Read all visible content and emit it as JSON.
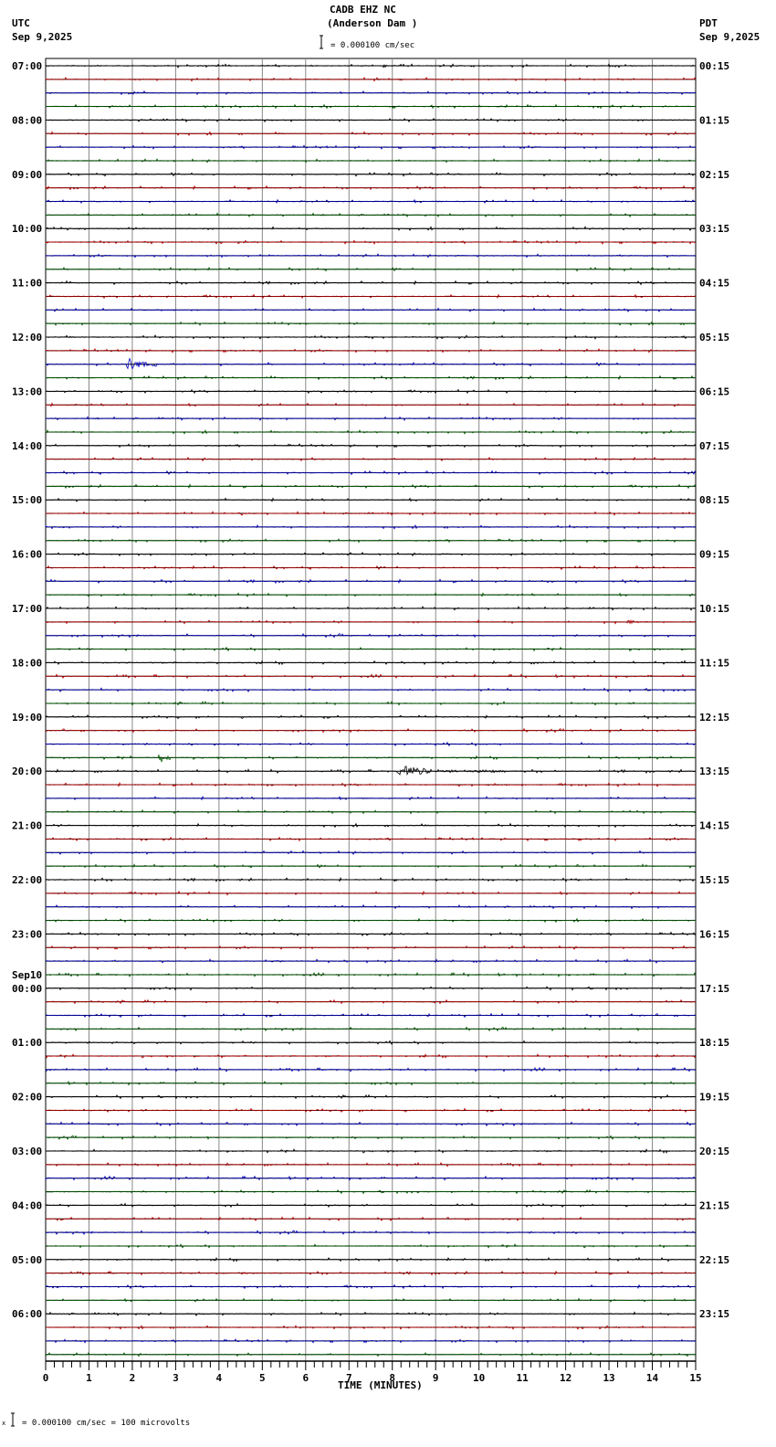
{
  "header": {
    "station": "CADB EHZ NC",
    "location": "(Anderson Dam )",
    "left_tz": "UTC",
    "left_date": "Sep 9,2025",
    "right_tz": "PDT",
    "right_date": "Sep 9,2025",
    "scale_label": "= 0.000100 cm/sec"
  },
  "footer": {
    "scale_note": "= 0.000100 cm/sec =     100 microvolts"
  },
  "chart_data": {
    "type": "line",
    "title": "CADB EHZ NC (Anderson Dam )",
    "xlabel": "TIME (MINUTES)",
    "xlim": [
      0,
      15
    ],
    "x_ticks": [
      "0",
      "1",
      "2",
      "3",
      "4",
      "5",
      "6",
      "7",
      "8",
      "9",
      "10",
      "11",
      "12",
      "13",
      "14",
      "15"
    ],
    "minor_tick_step": 0.2,
    "grid": true,
    "traces_per_hour": 4,
    "minutes_per_trace": 15,
    "trace_colors": [
      "#000000",
      "#c00000",
      "#0000c0",
      "#006000"
    ],
    "utc_labels": [
      "07:00",
      "08:00",
      "09:00",
      "10:00",
      "11:00",
      "12:00",
      "13:00",
      "14:00",
      "15:00",
      "16:00",
      "17:00",
      "18:00",
      "19:00",
      "20:00",
      "21:00",
      "22:00",
      "23:00",
      "00:00",
      "01:00",
      "02:00",
      "03:00",
      "04:00",
      "05:00",
      "06:00"
    ],
    "date_change": {
      "hour_index": 17,
      "label": "Sep10"
    },
    "pdt_labels": [
      "00:15",
      "01:15",
      "02:15",
      "03:15",
      "04:15",
      "05:15",
      "06:15",
      "07:15",
      "08:15",
      "09:15",
      "10:15",
      "11:15",
      "12:15",
      "13:15",
      "14:15",
      "15:15",
      "16:15",
      "17:15",
      "18:15",
      "19:15",
      "20:15",
      "21:15",
      "22:15",
      "23:15"
    ],
    "events": [
      {
        "hour_index": 5,
        "trace": 2,
        "start_min": 1.85,
        "end_min": 2.6,
        "amplitude": 18
      },
      {
        "hour_index": 8,
        "trace": 1,
        "start_min": 4.4,
        "end_min": 4.9,
        "amplitude": 3
      },
      {
        "hour_index": 10,
        "trace": 1,
        "start_min": 13.4,
        "end_min": 13.9,
        "amplitude": 4
      },
      {
        "hour_index": 12,
        "trace": 3,
        "start_min": 2.6,
        "end_min": 2.9,
        "amplitude": 14
      },
      {
        "hour_index": 13,
        "trace": 0,
        "start_min": 8.1,
        "end_min": 10.6,
        "amplitude": 8
      },
      {
        "hour_index": 16,
        "trace": 2,
        "start_min": 5.2,
        "end_min": 5.6,
        "amplitude": 2
      },
      {
        "hour_index": 22,
        "trace": 1,
        "start_min": 4.5,
        "end_min": 4.9,
        "amplitude": 3
      }
    ]
  }
}
